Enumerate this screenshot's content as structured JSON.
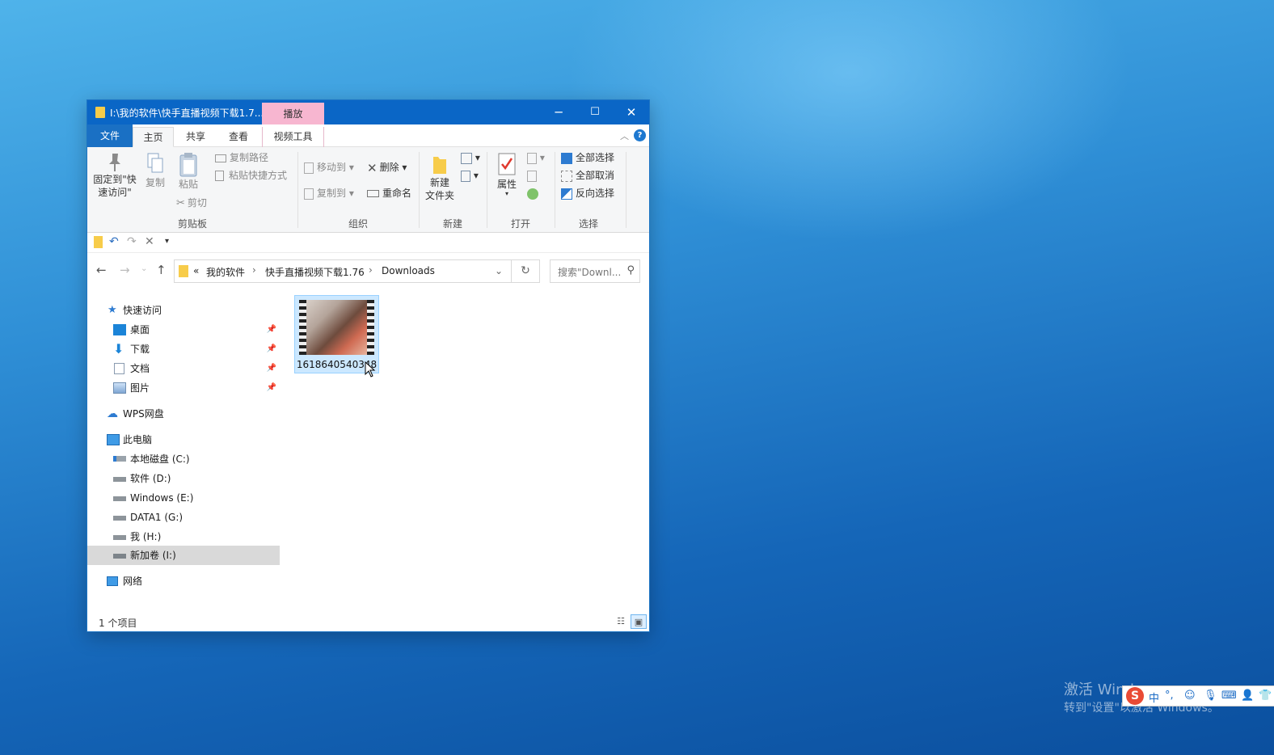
{
  "window": {
    "title": "I:\\我的软件\\快手直播视频下载1.7...",
    "context_tab": "播放",
    "controls": {
      "minimize": "─",
      "maximize": "☐",
      "close": "✕"
    }
  },
  "ribbon_tabs": {
    "file": "文件",
    "home": "主页",
    "share": "共享",
    "view": "查看",
    "video_tools": "视频工具"
  },
  "ribbon": {
    "clipboard": {
      "label": "剪贴板",
      "pin_line1": "固定到\"快",
      "pin_line2": "速访问\"",
      "copy": "复制",
      "paste": "粘贴",
      "copy_path": "复制路径",
      "paste_shortcut": "粘贴快捷方式",
      "cut": "剪切"
    },
    "organize": {
      "label": "组织",
      "move_to": "移动到",
      "copy_to": "复制到",
      "delete": "删除",
      "rename": "重命名"
    },
    "new": {
      "label": "新建",
      "new_folder_line1": "新建",
      "new_folder_line2": "文件夹"
    },
    "open": {
      "label": "打开",
      "properties": "属性"
    },
    "select": {
      "label": "选择",
      "select_all": "全部选择",
      "select_none": "全部取消",
      "invert": "反向选择"
    }
  },
  "address": {
    "prefix": "«",
    "crumbs": [
      "我的软件",
      "快手直播视频下载1.76",
      "Downloads"
    ],
    "search_placeholder": "搜索\"Downl..."
  },
  "nav": {
    "quick_access": "快速访问",
    "desktop": "桌面",
    "downloads": "下载",
    "documents": "文档",
    "pictures": "图片",
    "wps": "WPS网盘",
    "this_pc": "此电脑",
    "drive_c": "本地磁盘 (C:)",
    "drive_d": "软件 (D:)",
    "drive_e": "Windows (E:)",
    "drive_g": "DATA1 (G:)",
    "drive_h": "我 (H:)",
    "drive_i": "新加卷 (I:)",
    "network": "网络"
  },
  "files": [
    {
      "name": "1618640540348"
    }
  ],
  "status": {
    "item_count": "1 个项目"
  },
  "watermark": {
    "line1": "激活 Windows",
    "line2": "转到\"设置\"以激活 Windows。"
  },
  "ime": {
    "logo": "S",
    "mode": "中"
  },
  "colors": {
    "titlebar": "#0a66c6",
    "context_tab": "#f7b6d0",
    "selection": "#cce8ff"
  }
}
